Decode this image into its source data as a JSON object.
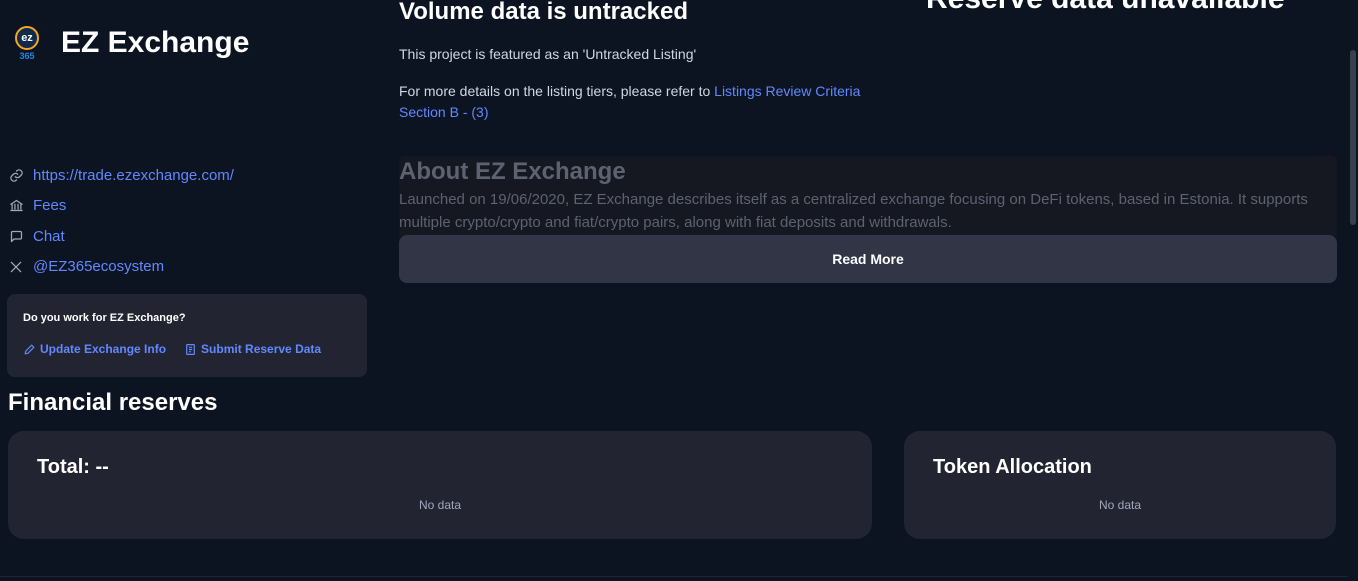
{
  "exchange": {
    "name": "EZ Exchange",
    "logo_text_top": "ez",
    "logo_text_bottom": "365"
  },
  "links": [
    {
      "icon": "link-icon",
      "label": "https://trade.ezexchange.com/"
    },
    {
      "icon": "bank-icon",
      "label": "Fees"
    },
    {
      "icon": "chat-icon",
      "label": "Chat"
    },
    {
      "icon": "x-twitter-icon",
      "label": "@EZ365ecosystem"
    }
  ],
  "work_box": {
    "question": "Do you work for EZ Exchange?",
    "update_label": "Update Exchange Info",
    "submit_label": "Submit Reserve Data"
  },
  "volume": {
    "title": "Volume data is untracked",
    "featured": "This project is featured as an 'Untracked Listing'",
    "details_prefix": "For more details on the listing tiers, please refer to ",
    "details_link": "Listings Review Criteria Section B - (3)"
  },
  "reserve_title": "Reserve data unavailable",
  "about": {
    "title": "About EZ Exchange",
    "text": "Launched on 19/06/2020, EZ Exchange describes itself as a centralized exchange focusing on DeFi tokens, based in Estonia. It supports multiple crypto/crypto and fiat/crypto pairs, along with fiat deposits and withdrawals.",
    "read_more": "Read More"
  },
  "financial_reserves": {
    "title": "Financial reserves",
    "total_title": "Total: --",
    "total_nodata": "No data",
    "allocation_title": "Token Allocation",
    "allocation_nodata": "No data"
  },
  "colors": {
    "background": "#0d1421",
    "card": "#222531",
    "link": "#6188ff",
    "button": "#323546"
  }
}
